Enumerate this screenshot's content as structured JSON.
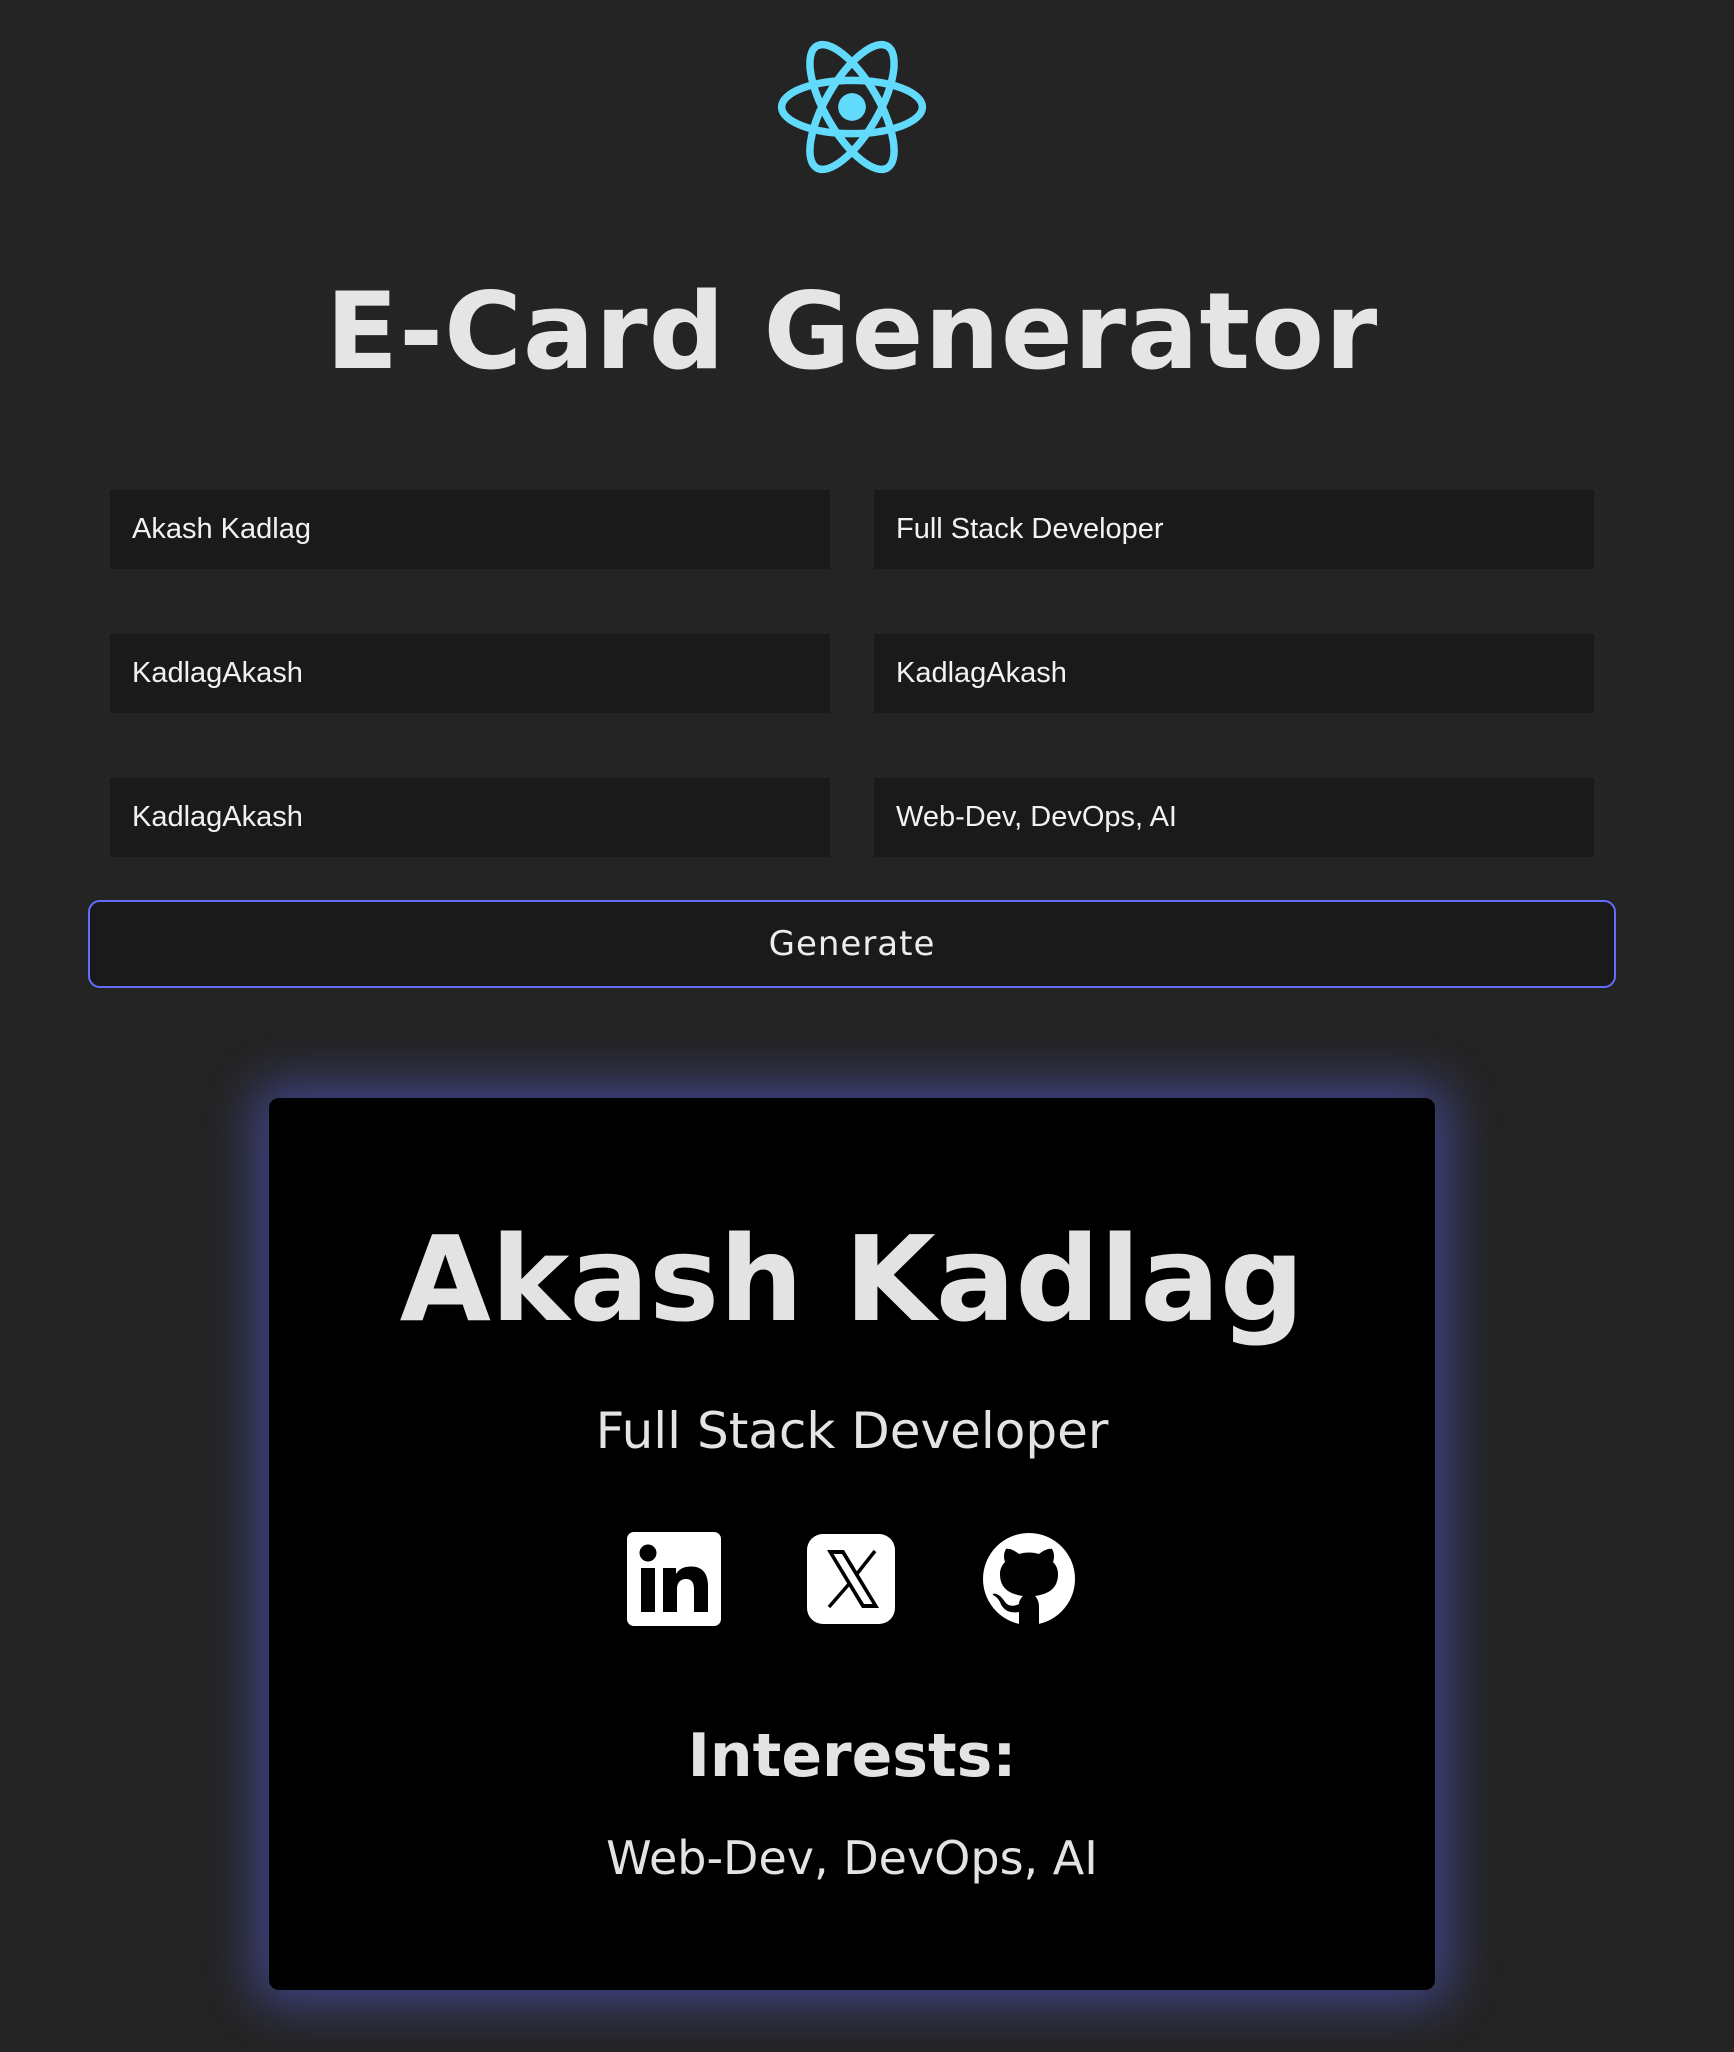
{
  "app": {
    "title": "E-Card Generator",
    "logo_icon": "react-atom-icon",
    "accent_color": "#646cff",
    "logo_color": "#61dafb"
  },
  "form": {
    "name": {
      "value": "Akash Kadlag"
    },
    "role": {
      "value": "Full Stack Developer"
    },
    "linkedin": {
      "value": "KadlagAkash"
    },
    "twitter": {
      "value": "KadlagAkash"
    },
    "github": {
      "value": "KadlagAkash"
    },
    "interests": {
      "value": "Web-Dev, DevOps, AI"
    },
    "generate_label": "Generate"
  },
  "card": {
    "name": "Akash Kadlag",
    "role": "Full Stack Developer",
    "socials": [
      {
        "icon": "linkedin-icon"
      },
      {
        "icon": "x-twitter-icon"
      },
      {
        "icon": "github-icon"
      }
    ],
    "interests_heading": "Interests:",
    "interests": "Web-Dev, DevOps, AI"
  }
}
